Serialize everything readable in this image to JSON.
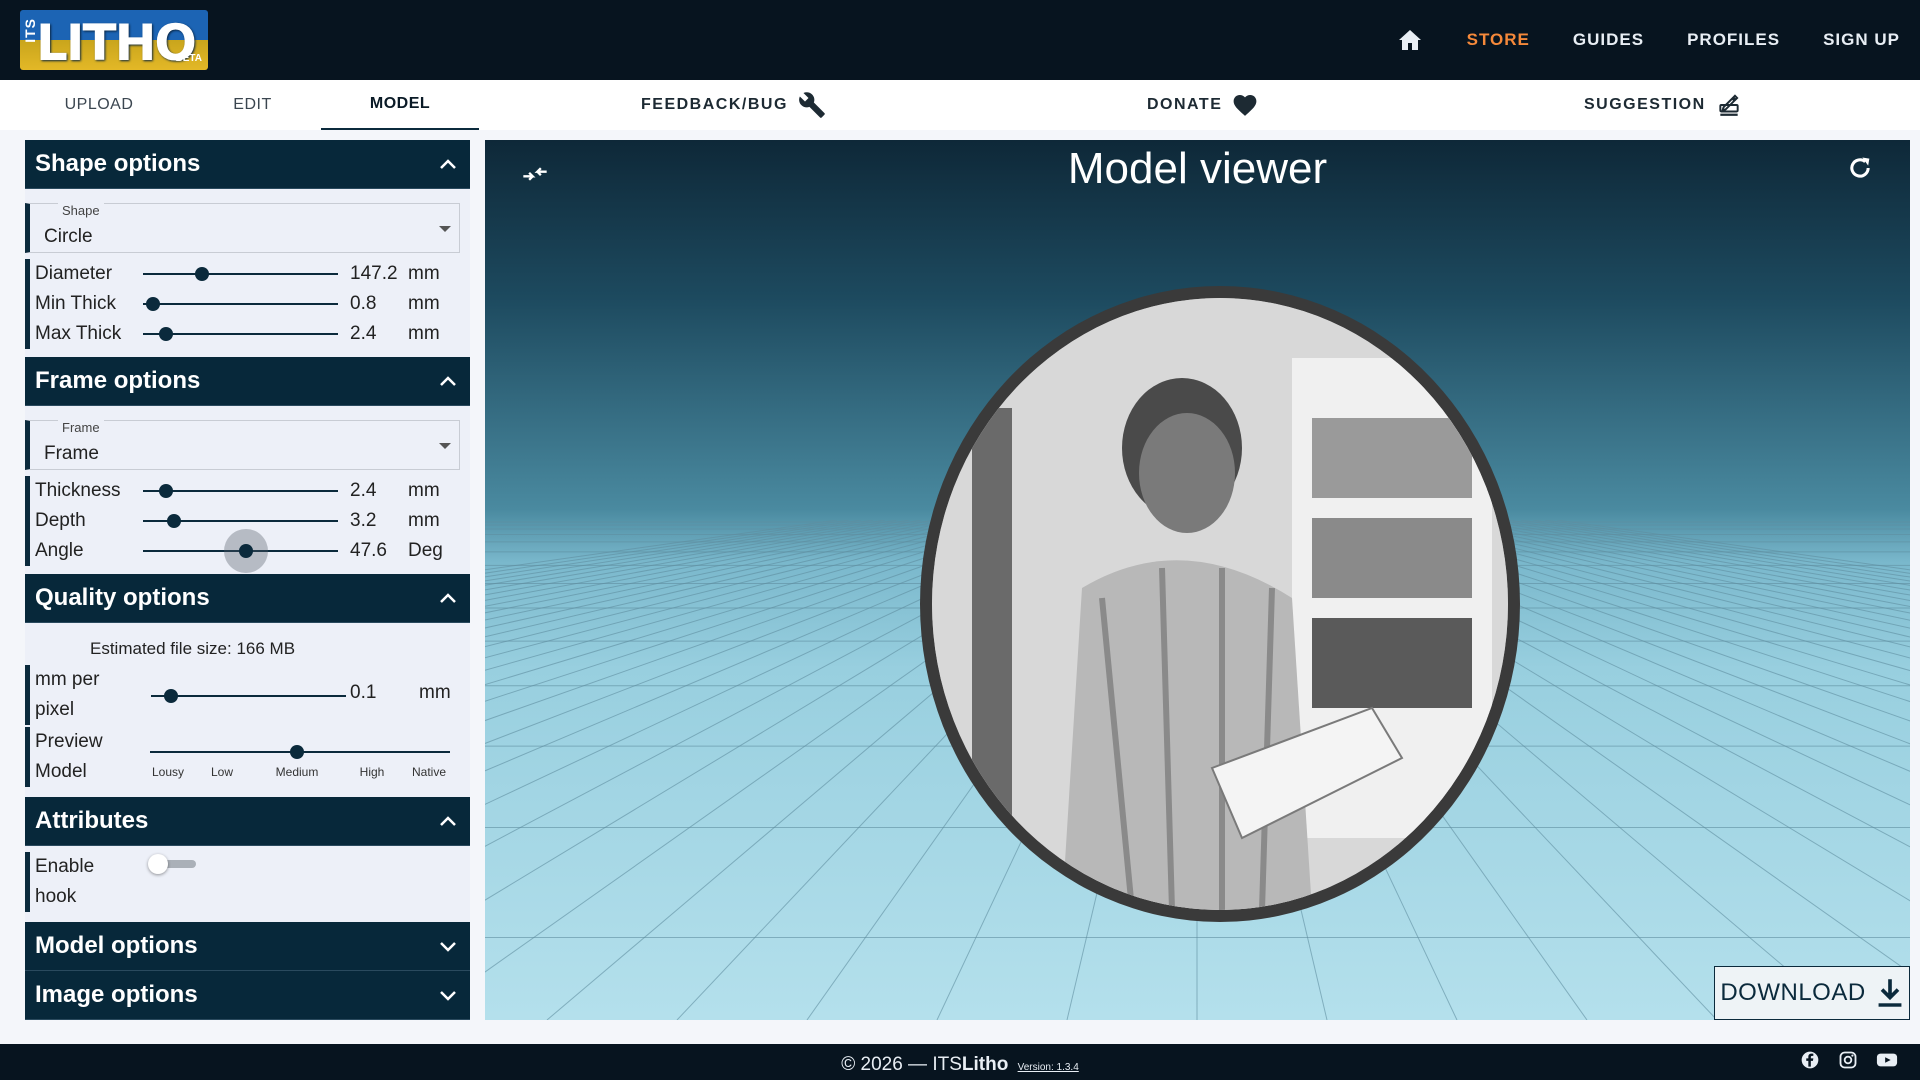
{
  "brand": {
    "side_text": "ITS",
    "word": "LITHO",
    "badge": "BETA"
  },
  "topnav": {
    "items": [
      "STORE",
      "GUIDES",
      "PROFILES",
      "SIGN UP"
    ],
    "accent": "#f5893a"
  },
  "subnav": {
    "tabs": [
      "UPLOAD",
      "EDIT",
      "MODEL"
    ],
    "active_tab": "MODEL",
    "actions": [
      "FEEDBACK/BUG",
      "DONATE",
      "SUGGESTION"
    ]
  },
  "shape_options": {
    "title": "Shape options",
    "select_label": "Shape",
    "select_value": "Circle",
    "rows": [
      {
        "label": "Diameter",
        "value": "147.2",
        "unit": "mm",
        "fraction": 0.3
      },
      {
        "label": "Min Thick",
        "value": "0.8",
        "unit": "mm",
        "fraction": 0.05
      },
      {
        "label": "Max Thick",
        "value": "2.4",
        "unit": "mm",
        "fraction": 0.12
      }
    ]
  },
  "frame_options": {
    "title": "Frame options",
    "select_label": "Frame",
    "select_value": "Frame",
    "rows": [
      {
        "label": "Thickness",
        "value": "2.4",
        "unit": "mm",
        "fraction": 0.12
      },
      {
        "label": "Depth",
        "value": "3.2",
        "unit": "mm",
        "fraction": 0.16
      },
      {
        "label": "Angle",
        "value": "47.6",
        "unit": "Deg",
        "fraction": 0.53
      }
    ]
  },
  "quality_options": {
    "title": "Quality options",
    "estimate": "Estimated file size: 166 MB",
    "mm_per_pixel": {
      "label_line1": "mm per",
      "label_line2": "pixel",
      "value": "0.1",
      "unit": "mm",
      "fraction": 0.1
    },
    "preview": {
      "label_line1": "Preview",
      "label_line2": "Model",
      "marks": [
        "Lousy",
        "Low",
        "Medium",
        "High",
        "Native"
      ],
      "selected_index": 2
    }
  },
  "attributes": {
    "title": "Attributes",
    "hook_line1": "Enable",
    "hook_line2": "hook",
    "hook_enabled": false
  },
  "model_options": {
    "title": "Model options"
  },
  "image_options": {
    "title": "Image options"
  },
  "viewer": {
    "title": "Model viewer",
    "download": "DOWNLOAD"
  },
  "footer": {
    "copyright": "© 2026 — ITS",
    "brand_bold": "Litho",
    "version": "Version: 1.3.4"
  }
}
